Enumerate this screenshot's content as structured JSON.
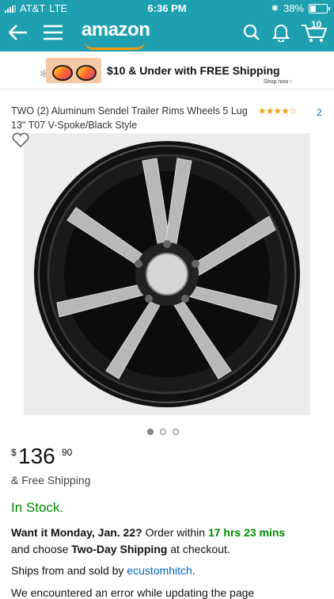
{
  "status": {
    "carrier": "AT&T",
    "network": "LTE",
    "time": "6:36 PM",
    "battery": "38%",
    "battery_level": 0.38
  },
  "nav": {
    "logo": "amazon",
    "cart_count": "10"
  },
  "banner": {
    "promo": "$10 & Under with FREE Shipping",
    "shop": "Shop now ›"
  },
  "product": {
    "title": "TWO (2) Aluminum Sendel Trailer Rims Wheels 5 Lug 13\" T07 V-Spoke/Black Style",
    "stars": "★★★★☆",
    "rating": 4,
    "review_count": "2",
    "image_dots": 3,
    "active_image": 1,
    "price_symbol": "$",
    "price_whole": "136",
    "price_fraction": "90",
    "shipping": "& Free Shipping",
    "stock": "In Stock.",
    "delivery": {
      "want": "Want it Monday, Jan. 22?",
      "order_within": "Order within",
      "countdown": "17 hrs 23 mins",
      "and_choose": "and choose",
      "shipping_option": "Two-Day Shipping",
      "at_checkout": "at checkout."
    },
    "ships_from": "Ships from and sold by",
    "seller": "ecustomhitch",
    "seller_period": ".",
    "error": "We encountered an error while updating the page"
  },
  "colors": {
    "header": "#1ea0b0",
    "in_stock": "#008a00",
    "link": "#0066c0",
    "stars": "#f0a31c"
  }
}
